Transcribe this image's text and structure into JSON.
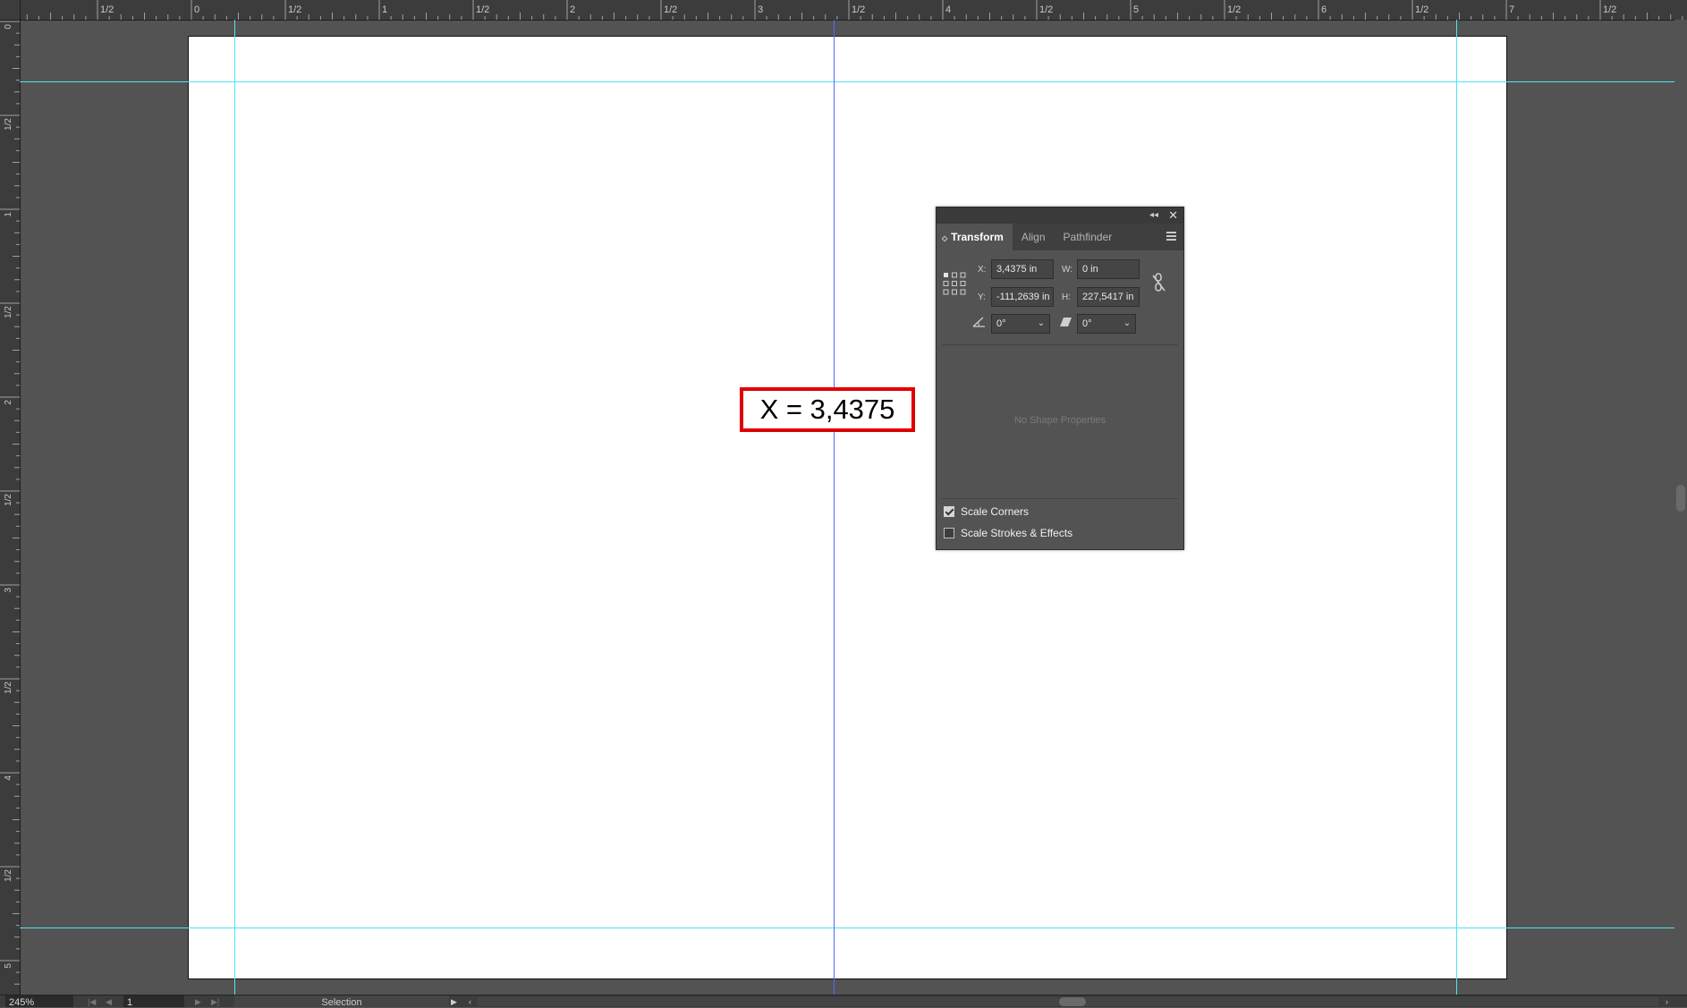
{
  "ruler": {
    "top_labels": [
      "1/2",
      "0",
      "1/2",
      "1",
      "1/2",
      "2",
      "1/2",
      "3",
      "1/2",
      "4",
      "1/2",
      "5",
      "1/2",
      "6",
      "1/2",
      "7",
      "1/2"
    ],
    "left_labels": [
      "0",
      "1/2",
      "1",
      "1/2",
      "2",
      "1/2",
      "3",
      "1/2",
      "4",
      "1/2",
      "5"
    ]
  },
  "annotation": {
    "text": "X = 3,4375"
  },
  "panel": {
    "tabs": [
      {
        "label": "Transform",
        "active": true
      },
      {
        "label": "Align",
        "active": false
      },
      {
        "label": "Pathfinder",
        "active": false
      }
    ],
    "x_label": "X:",
    "x_value": "3,4375 in",
    "y_label": "Y:",
    "y_value": "-111,2639 in",
    "w_label": "W:",
    "w_value": "0 in",
    "h_label": "H:",
    "h_value": "227,5417 in",
    "rotate_value": "0°",
    "shear_value": "0°",
    "no_shape_text": "No Shape Properties",
    "scale_corners": {
      "label": "Scale Corners",
      "checked": true
    },
    "scale_strokes": {
      "label": "Scale Strokes & Effects",
      "checked": false
    }
  },
  "statusbar": {
    "zoom": "245%",
    "page": "1",
    "tool": "Selection"
  },
  "colors": {
    "guide": "#4ee6f0",
    "path": "#4d6bff",
    "annotation_border": "#e00000"
  }
}
